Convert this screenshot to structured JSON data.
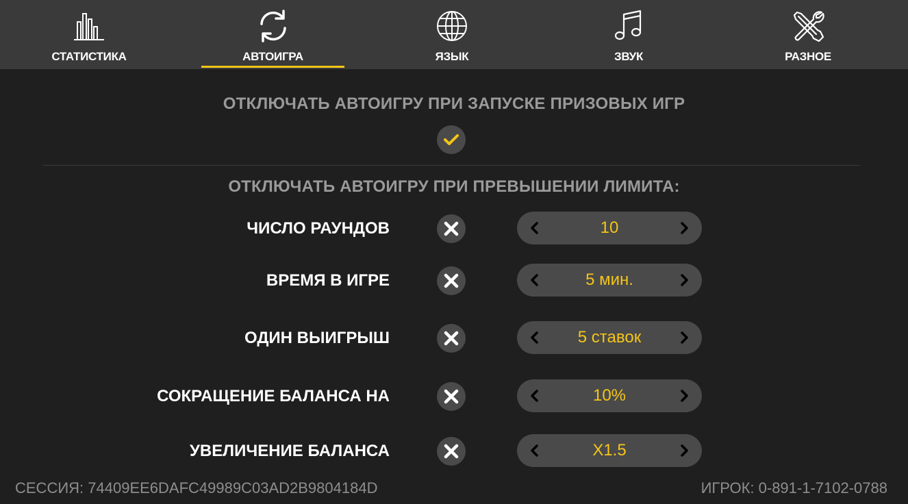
{
  "tabs": [
    {
      "label": "СТАТИСТИКА",
      "icon": "bar-chart-icon"
    },
    {
      "label": "АВТОИГРА",
      "icon": "refresh-icon",
      "active": true
    },
    {
      "label": "ЯЗЫК",
      "icon": "globe-icon"
    },
    {
      "label": "ЗВУК",
      "icon": "music-note-icon"
    },
    {
      "label": "РАЗНОЕ",
      "icon": "tools-icon"
    }
  ],
  "colors": {
    "accent": "#f5c518",
    "background": "#1f1f1f",
    "tabbar": "#3a3a3a",
    "control": "#4a4a4a"
  },
  "prize_section": {
    "title": "ОТКЛЮЧАТЬ АВТОИГРУ ПРИ ЗАПУСКЕ ПРИЗОВЫХ ИГР",
    "checked": true
  },
  "limit_section": {
    "title": "ОТКЛЮЧАТЬ АВТОИГРУ ПРИ ПРЕВЫШЕНИИ ЛИМИТА:",
    "rows": [
      {
        "label": "ЧИСЛО РАУНДОВ",
        "value": "10",
        "enabled": false
      },
      {
        "label": "ВРЕМЯ В ИГРЕ",
        "value": "5 мин.",
        "enabled": false
      },
      {
        "label": "ОДИН ВЫИГРЫШ",
        "value": "5 ставок",
        "enabled": false
      },
      {
        "label": "СОКРАЩЕНИЕ БАЛАНСА НА",
        "value": "10%",
        "enabled": false
      },
      {
        "label": "УВЕЛИЧЕНИЕ БАЛАНСА",
        "value": "X1.5",
        "enabled": false
      }
    ]
  },
  "footer": {
    "session": "СЕССИЯ: 74409EE6DAFC49989C03AD2B9804184D",
    "player": "ИГРОК: 0-891-1-7102-0788"
  }
}
